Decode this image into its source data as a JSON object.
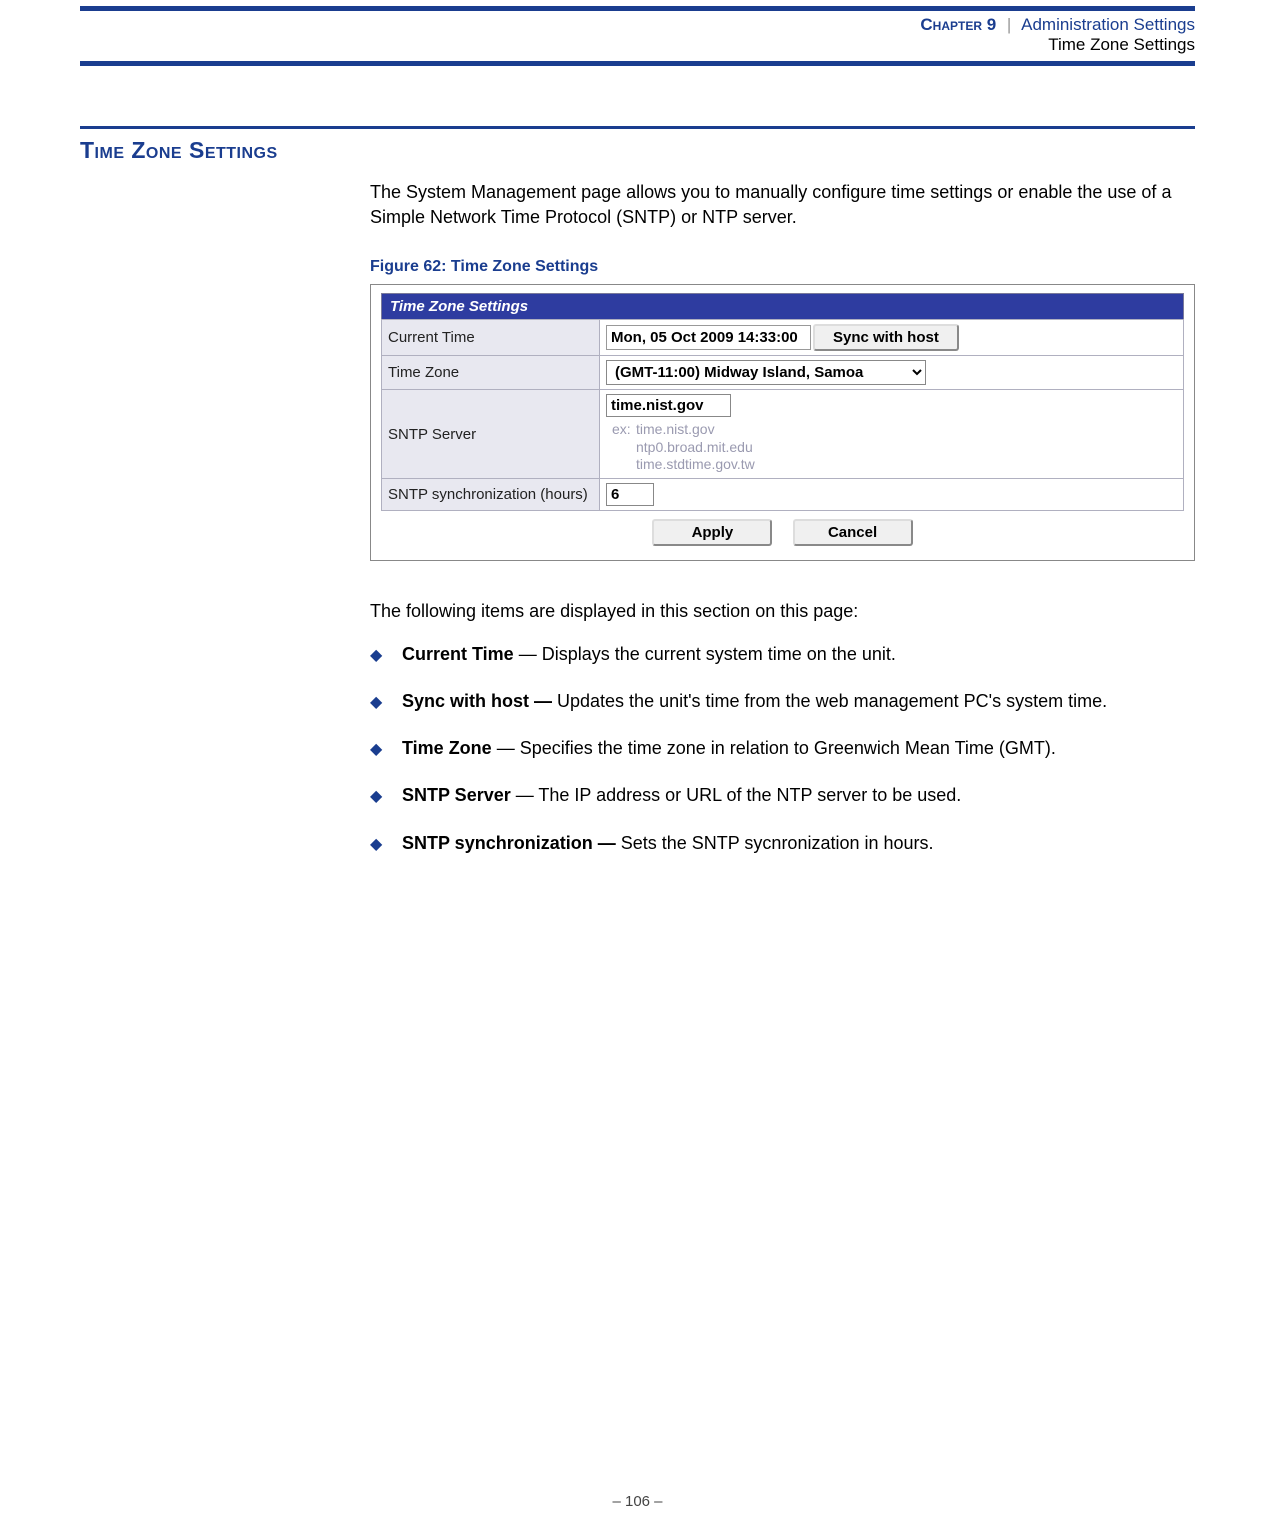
{
  "header": {
    "chapter": "Chapter 9",
    "separator": "|",
    "admin": "Administration Settings",
    "subtitle": "Time Zone Settings"
  },
  "section": {
    "heading": "Time Zone Settings",
    "intro": "The System Management page allows you to manually configure time settings or enable the use of a Simple Network Time Protocol (SNTP) or NTP server."
  },
  "figure": {
    "caption": "Figure 62:  Time Zone Settings",
    "panel_title": "Time Zone Settings",
    "rows": {
      "current_time": {
        "label": "Current Time",
        "value": "Mon, 05 Oct 2009 14:33:00",
        "sync_label": "Sync with host"
      },
      "time_zone": {
        "label": "Time Zone",
        "value": "(GMT-11:00) Midway Island, Samoa"
      },
      "sntp_server": {
        "label": "SNTP Server",
        "value": "time.nist.gov",
        "ex_label": "ex:",
        "ex1": "time.nist.gov",
        "ex2": "ntp0.broad.mit.edu",
        "ex3": "time.stdtime.gov.tw"
      },
      "sntp_sync": {
        "label": "SNTP synchronization (hours)",
        "value": "6"
      }
    },
    "buttons": {
      "apply": "Apply",
      "cancel": "Cancel"
    }
  },
  "list_intro": "The following items are displayed in this section on this page:",
  "bullets": [
    {
      "label": "Current Time",
      "text": " — Displays the current system time on the unit."
    },
    {
      "label": "Sync with host —",
      "text": " Updates the unit's time from the web management PC's system time."
    },
    {
      "label": "Time Zone",
      "text": " — Specifies the time zone in relation to Greenwich Mean Time (GMT)."
    },
    {
      "label": "SNTP Server",
      "text": " — The IP address or URL of the NTP server to be used."
    },
    {
      "label": "SNTP synchronization —",
      "text": " Sets the SNTP sycnronization in hours."
    }
  ],
  "footer": {
    "page": "–  106  –"
  }
}
